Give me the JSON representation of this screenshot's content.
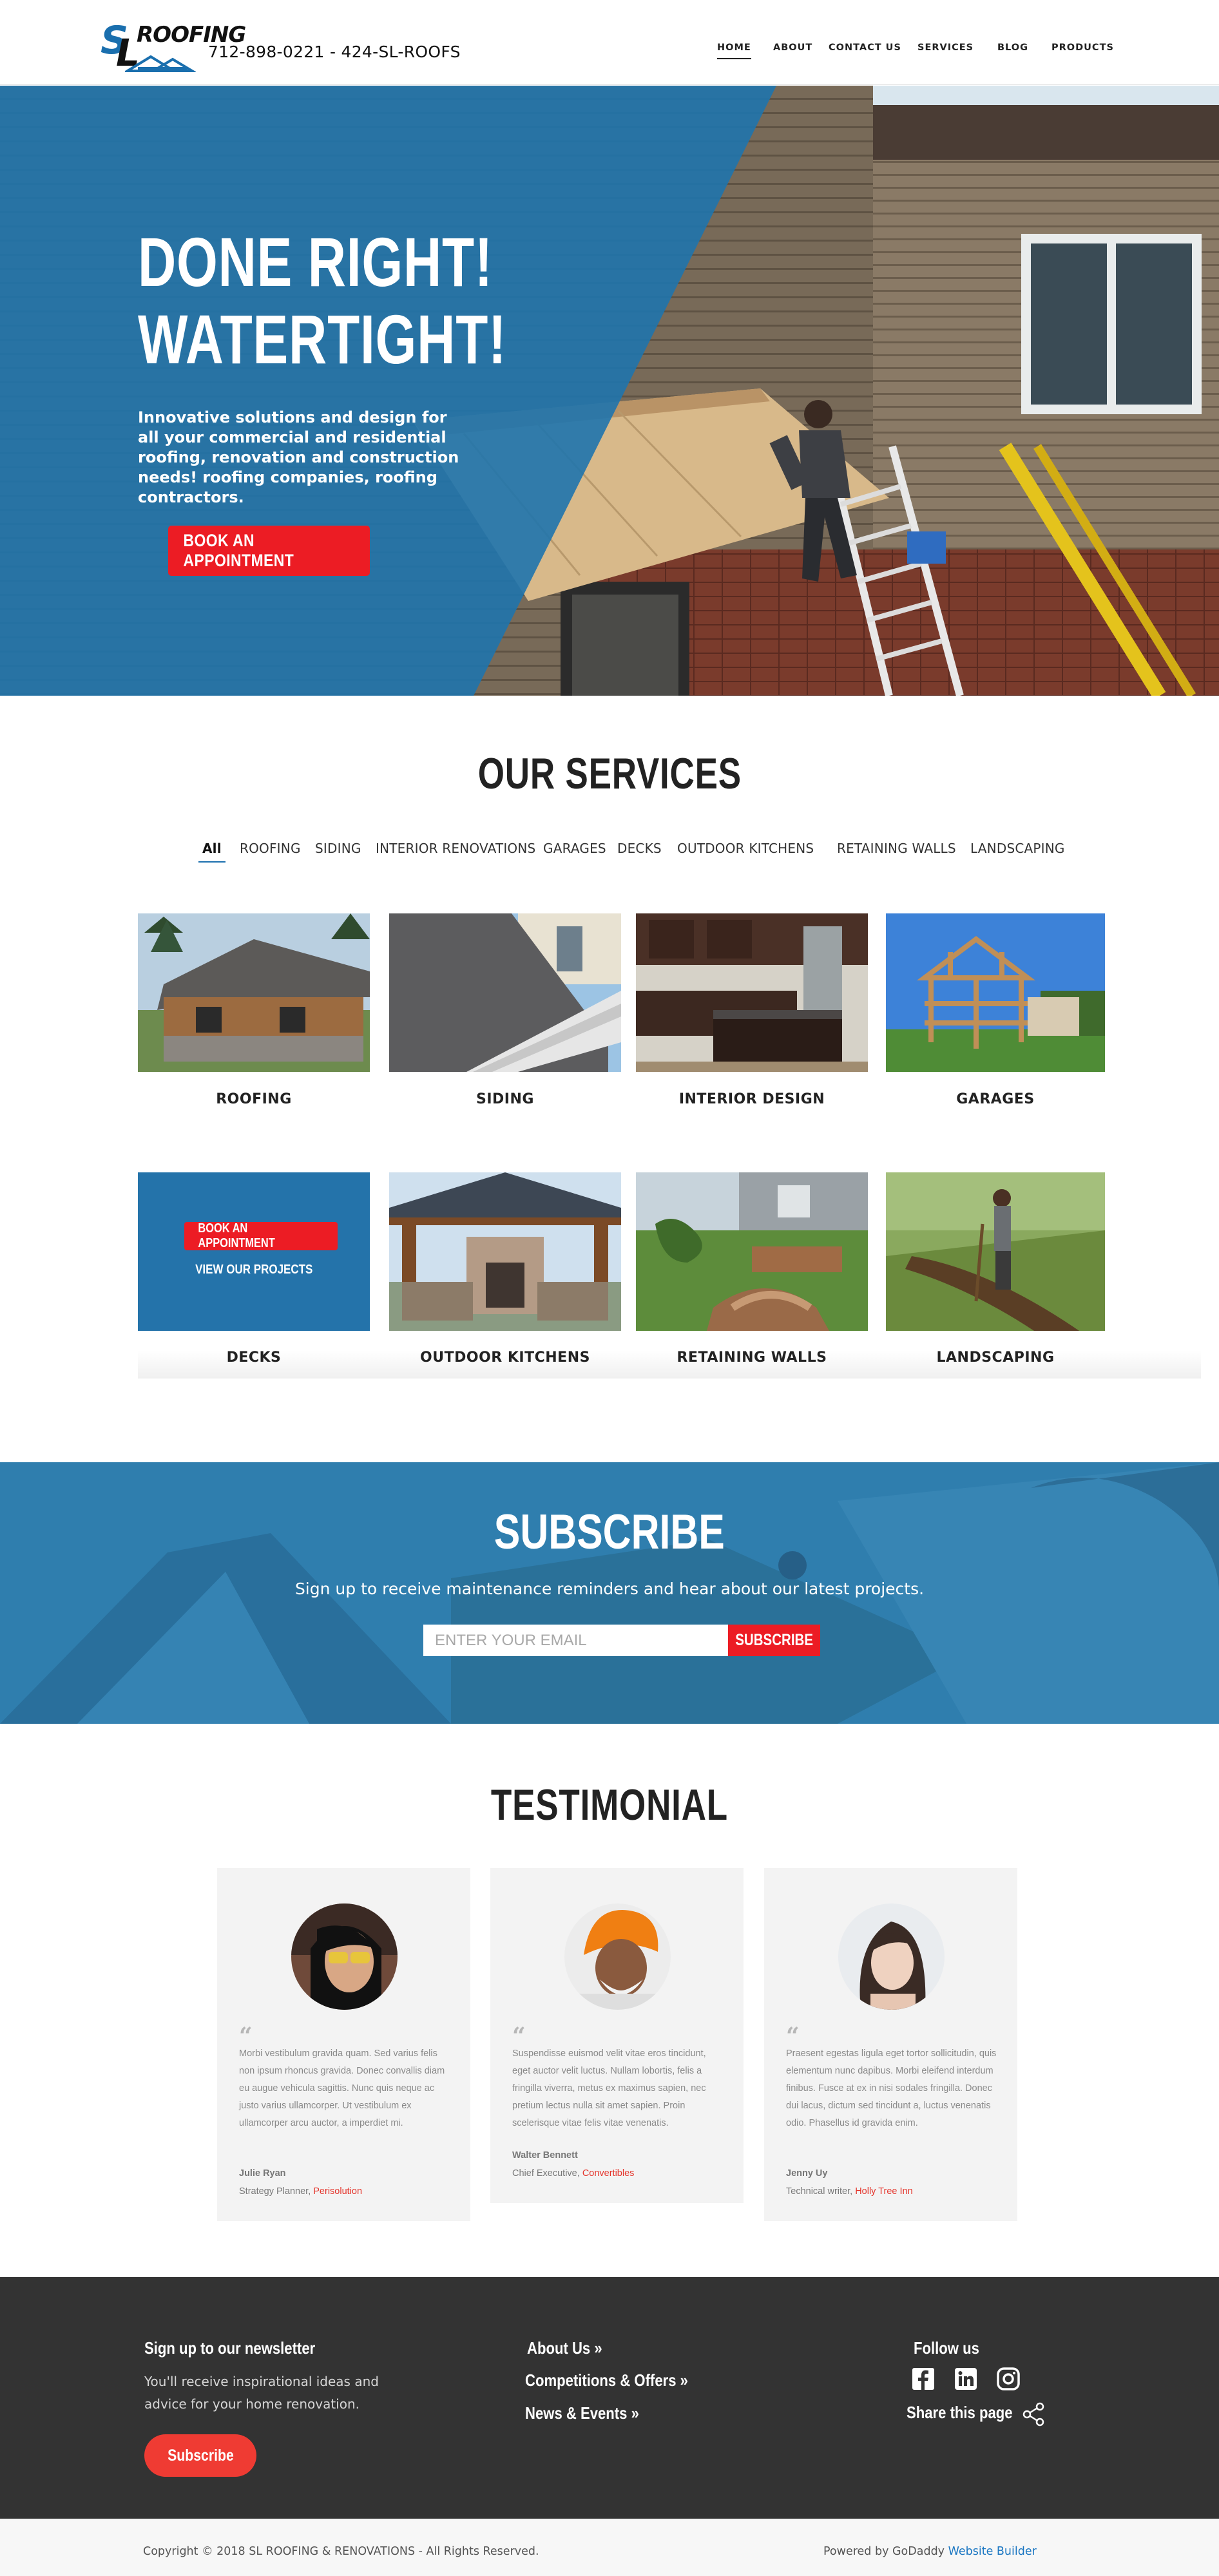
{
  "header": {
    "logo_text": "SL ROOFING",
    "phone": "712-898-0221 - 424-SL-ROOFS",
    "nav": [
      {
        "label": "HOME",
        "active": true
      },
      {
        "label": "ABOUT"
      },
      {
        "label": "CONTACT US"
      },
      {
        "label": "SERVICES"
      },
      {
        "label": "BLOG"
      },
      {
        "label": "PRODUCTS"
      }
    ]
  },
  "hero": {
    "title_line1": "DONE RIGHT!",
    "title_line2": "WATERTIGHT!",
    "subtitle": "Innovative solutions and design for all your commercial and residential  roofing, renovation and construction needs! roofing companies, roofing contractors.",
    "cta": "BOOK AN APPOINTMENT"
  },
  "services": {
    "title": "OUR SERVICES",
    "filters": [
      "All",
      "ROOFING",
      "SIDING",
      "INTERIOR RENOVATIONS",
      "GARAGES",
      "DECKS",
      "OUTDOOR KITCHENS",
      "RETAINING WALLS",
      "LANDSCAPING"
    ],
    "active_filter": "All",
    "cards": [
      {
        "label": "ROOFING"
      },
      {
        "label": "SIDING"
      },
      {
        "label": "INTERIOR DESIGN"
      },
      {
        "label": "GARAGES"
      },
      {
        "label": "DECKS"
      },
      {
        "label": "OUTDOOR KITCHENS"
      },
      {
        "label": "RETAINING WALLS"
      },
      {
        "label": "LANDSCAPING"
      }
    ],
    "overlay_button": "BOOK AN APPOINTMENT",
    "overlay_link": "VIEW OUR PROJECTS"
  },
  "subscribe": {
    "title": "SUBSCRIBE",
    "text": "Sign up to receive maintenance reminders and hear about our latest projects.",
    "placeholder": "ENTER YOUR EMAIL",
    "button": "SUBSCRIBE"
  },
  "testimonials": {
    "title": "TESTIMONIAL",
    "items": [
      {
        "quote": "Morbi vestibulum gravida quam. Sed varius felis non ipsum rhoncus gravida. Donec convallis diam eu augue vehicula sagittis. Nunc quis neque ac justo varius ullamcorper. Ut vestibulum ex ullamcorper arcu auctor, a imperdiet mi.",
        "name": "Julie Ryan",
        "role": "Strategy Planner, ",
        "company": "Perisolution"
      },
      {
        "quote": "Suspendisse euismod velit vitae eros tincidunt, eget auctor velit luctus. Nullam lobortis, felis a fringilla viverra, metus ex maximus sapien, nec pretium lectus nulla sit amet sapien. Proin scelerisque vitae felis vitae venenatis.",
        "name": "Walter Bennett",
        "role": "Chief Executive, ",
        "company": "Convertibles"
      },
      {
        "quote": "Praesent egestas ligula eget tortor sollicitudin, quis elementum nunc dapibus. Morbi eleifend interdum finibus. Fusce at ex in nisi sodales fringilla. Donec dui lacus, dictum sed tincidunt a, luctus venenatis odio. Phasellus id gravida enim.",
        "name": "Jenny Uy",
        "role": "Technical writer, ",
        "company": "Holly Tree Inn"
      }
    ]
  },
  "footer": {
    "newsletter_title": "Sign up to our newsletter",
    "newsletter_text": "You'll receive inspirational ideas and advice for your home renovation.",
    "newsletter_button": "Subscribe",
    "links": [
      "About Us »",
      "Competitions & Offers »",
      "News & Events »"
    ],
    "follow_title": "Follow us",
    "social_icons": [
      "facebook-icon",
      "linkedin-icon",
      "instagram-icon"
    ],
    "share_label": "Share this page",
    "copyright": "Copyright © 2018 SL ROOFING & RENOVATIONS - All Rights Reserved.",
    "powered_prefix": "Powered by GoDaddy ",
    "powered_link": "Website Builder"
  },
  "colors": {
    "brand_blue": "#1a6fae",
    "accent_red": "#ec1c24",
    "footer_bg": "#333333"
  }
}
